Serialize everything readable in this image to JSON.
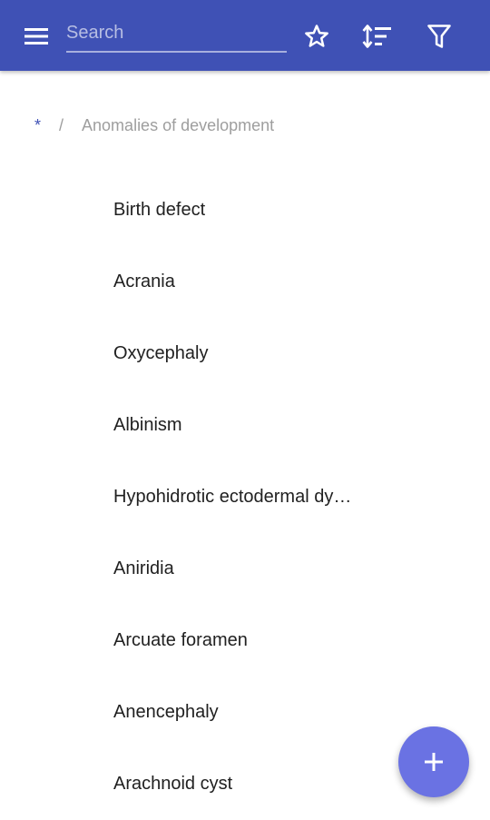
{
  "appbar": {
    "background": "#3f51b5",
    "menu_icon": "menu-icon",
    "search": {
      "placeholder": "Search",
      "value": ""
    },
    "actions": [
      {
        "icon": "star-outline-icon"
      },
      {
        "icon": "sort-icon"
      },
      {
        "icon": "filter-icon"
      }
    ]
  },
  "breadcrumb": {
    "root": "*",
    "separator": "/",
    "current": "Anomalies of development"
  },
  "list": {
    "items": [
      {
        "label": "Birth defect"
      },
      {
        "label": "Acrania"
      },
      {
        "label": "Oxycephaly"
      },
      {
        "label": "Albinism"
      },
      {
        "label": "Hypohidrotic ectodermal dy…"
      },
      {
        "label": "Aniridia"
      },
      {
        "label": "Arcuate foramen"
      },
      {
        "label": "Anencephaly"
      },
      {
        "label": "Arachnoid cyst"
      }
    ]
  },
  "fab": {
    "icon": "plus-icon",
    "color": "#6a72e3"
  }
}
